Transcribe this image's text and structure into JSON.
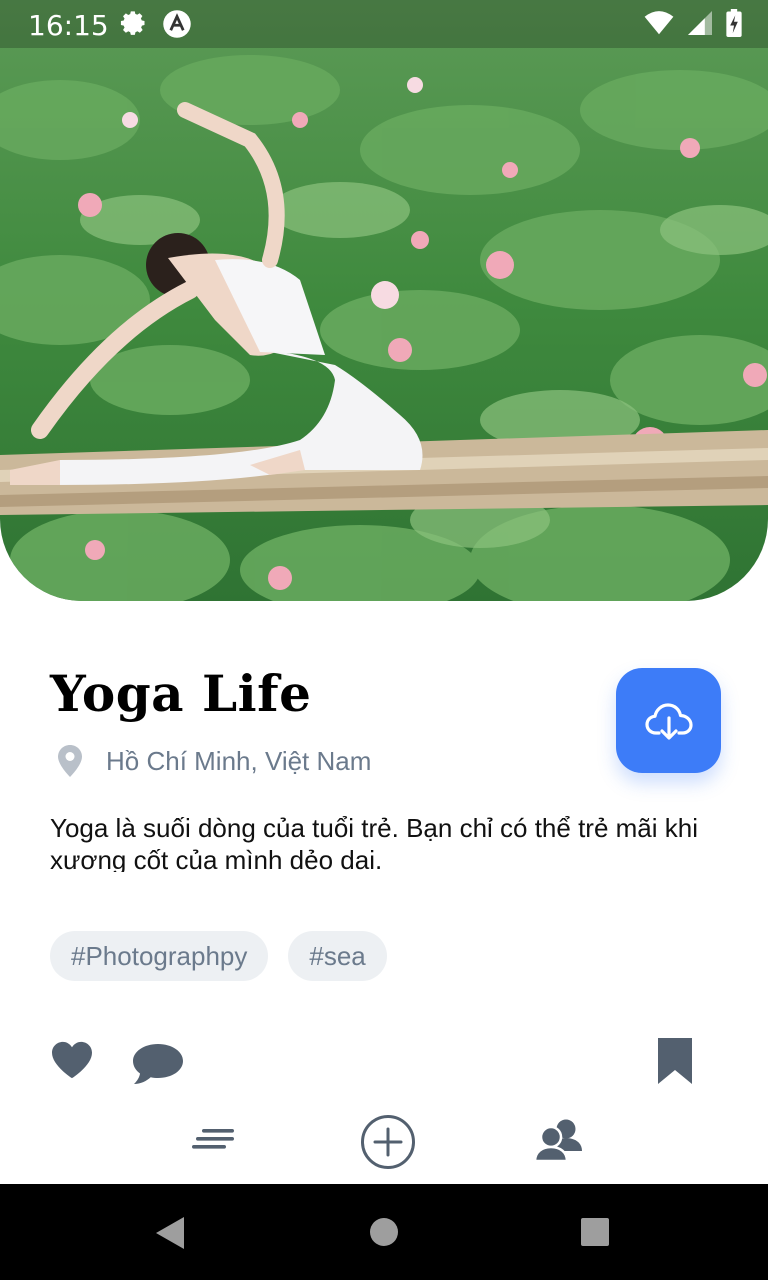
{
  "status_bar": {
    "time": "16:15",
    "icons": [
      "settings-gear-icon",
      "app-a-icon",
      "wifi-icon",
      "signal-icon",
      "battery-charging-icon"
    ]
  },
  "hero_image": {
    "subject": "yoga-pose-on-bamboo-deck-in-lotus-pond",
    "colors": {
      "leaf": "#4e9446",
      "flower": "#f0a9b8",
      "outfit": "#f4f4f6"
    }
  },
  "post": {
    "title": "Yoga Life",
    "location": "Hồ Chí Minh, Việt Nam",
    "description": "Yoga là suối dòng của tuổi trẻ. Bạn chỉ có thể trẻ mãi khi xương cốt của mình dẻo dai.",
    "tags": [
      "#Photographpy",
      "#sea"
    ],
    "download_icon": "cloud-download-icon"
  },
  "actions": {
    "like_icon": "heart-icon",
    "comment_icon": "comment-icon",
    "bookmark_icon": "bookmark-icon"
  },
  "bottom_tabs": [
    "feed-lines-icon",
    "add-circle-icon",
    "people-icon"
  ],
  "system_nav": [
    "back-icon",
    "home-icon",
    "recents-icon"
  ],
  "colors": {
    "accent": "#3d7cf8",
    "muted": "#6b7a8c",
    "icon": "#53606f",
    "tag_bg": "#edf0f3"
  }
}
